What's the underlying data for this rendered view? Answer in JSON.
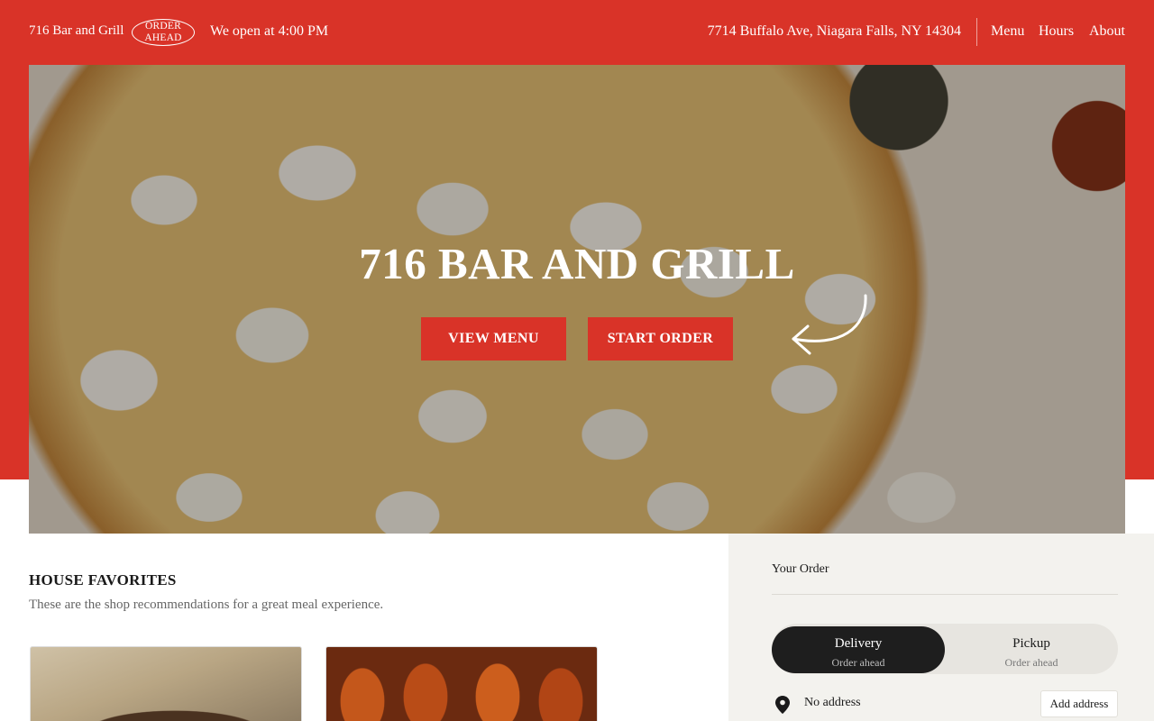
{
  "header": {
    "brand": "716 Bar and Grill",
    "order_badge": "ORDER AHEAD",
    "open_text": "We open at 4:00 PM",
    "address": "7714 Buffalo Ave, Niagara Falls, NY 14304",
    "nav": {
      "menu": "Menu",
      "hours": "Hours",
      "about": "About"
    }
  },
  "hero": {
    "title": "716 BAR AND GRILL",
    "view_menu": "VIEW MENU",
    "start_order": "START ORDER",
    "icons": [
      "curved-arrow-icon"
    ]
  },
  "favorites": {
    "title": "HOUSE FAVORITES",
    "subtitle": "These are the shop recommendations for a great meal experience."
  },
  "order_panel": {
    "title": "Your Order",
    "delivery": {
      "label": "Delivery",
      "sub": "Order ahead"
    },
    "pickup": {
      "label": "Pickup",
      "sub": "Order ahead"
    },
    "address_text": "No address",
    "add_address": "Add address",
    "icons": [
      "location-pin-icon"
    ]
  },
  "colors": {
    "accent": "#d93328",
    "dark": "#1e1e1e",
    "panel_bg": "#f3f2ee"
  }
}
